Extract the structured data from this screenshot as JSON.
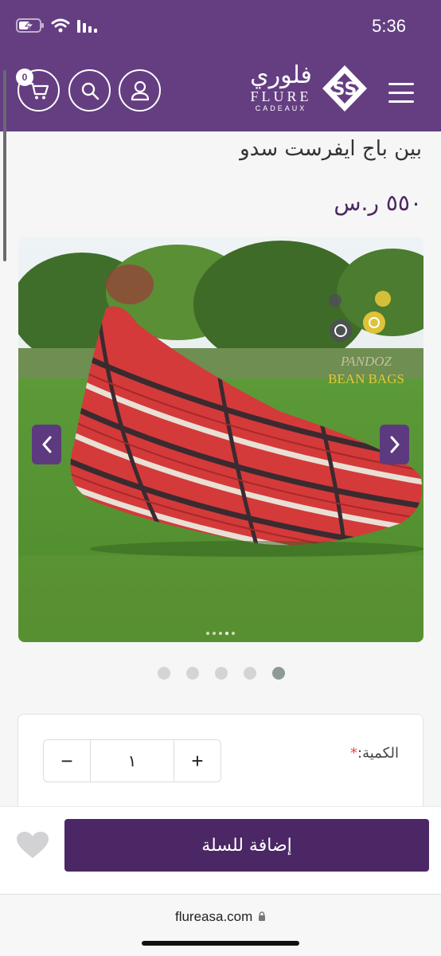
{
  "status_bar": {
    "time": "5:36"
  },
  "header": {
    "cart_count": "0",
    "logo": {
      "arabic": "فلوري",
      "english": "FLURE",
      "sub": "CADEAUX"
    }
  },
  "product": {
    "title": "بين باج ايفرست سدو",
    "price": "٥٥٠ ر.س",
    "image_watermark": [
      "PANDOZ",
      "BEAN BAGS"
    ],
    "gallery_pages": 5,
    "active_page": 5
  },
  "quantity": {
    "label": "الكمية:",
    "required_mark": "*",
    "value": "١",
    "minus": "−",
    "plus": "+"
  },
  "actions": {
    "add_to_cart": "إضافة للسلة"
  },
  "browser": {
    "url": "flureasa.com"
  },
  "colors": {
    "brand": "#653e82",
    "button": "#4b2766",
    "price": "#4b275f",
    "required": "#e74c3c"
  }
}
